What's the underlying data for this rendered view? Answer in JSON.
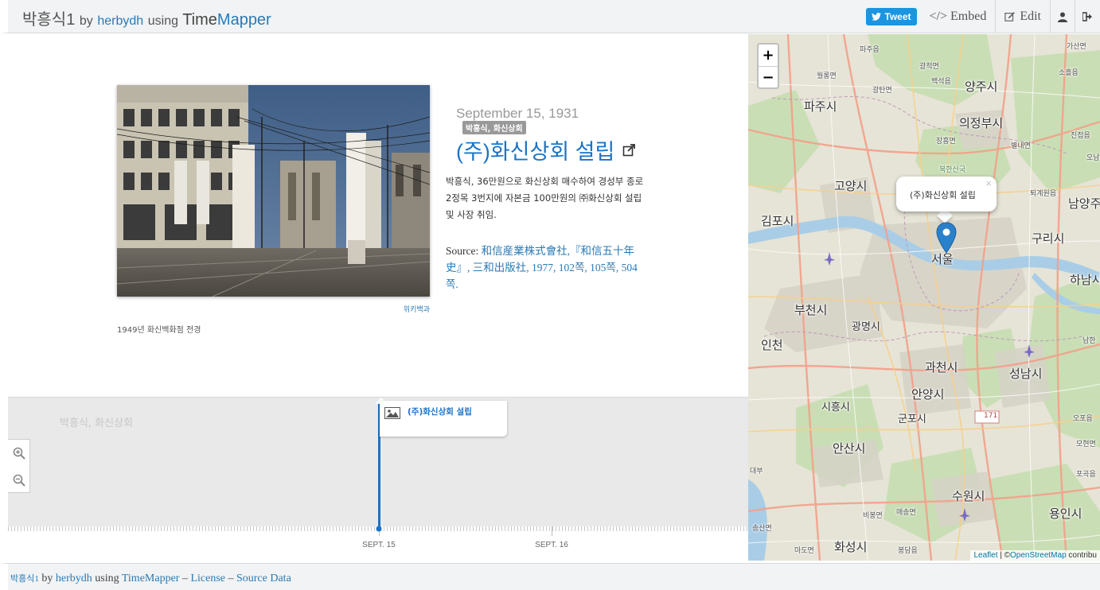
{
  "header": {
    "title": "박흥식1",
    "by": "by",
    "author": "herbydh",
    "using": "using",
    "app_name_1": "Time",
    "app_name_2": "Mapper",
    "tweet_label": "Tweet",
    "embed_label": "</> Embed",
    "edit_label": "Edit"
  },
  "slide": {
    "date": "September 15, 1931",
    "tag": "박흥식, 화신상회",
    "headline": "(주)화신상회 설립",
    "body": "박흥식, 36만원으로 화신상회 매수하여 경성부 종로 2정목 3번지에 자본금 100만원의 ㈜화신상회 설립 및 사장 취임.",
    "source_prefix": "Source:",
    "source_link": "和信産業株式會社,『和信五十年史』, 三和出版社, 1977, 102쪽, 105쪽, 504쪽.",
    "media_credit": "위키백과",
    "media_caption": "1949년 화신백화점 전경"
  },
  "timeline": {
    "group_label": "박흥식, 화신상회",
    "event_title": "(주)화신상회 설립",
    "tick_labels": [
      "SEPT. 15",
      "SEPT. 16"
    ]
  },
  "map": {
    "popup_text": "(주)화신상회 설립",
    "popup_close": "×",
    "zoom_in": "+",
    "zoom_out": "−",
    "attribution_leaflet": "Leaflet",
    "attribution_sep": " | ©",
    "attribution_osm": "OpenStreetMap",
    "attribution_tail": " contribu",
    "road_number": "171",
    "places": {
      "seoul": "서울",
      "goyang": "고양시",
      "gimpo": "김포시",
      "bucheon": "부천시",
      "incheon": "인천",
      "gwangmyeong": "광명시",
      "uijeongbu": "의정부시",
      "yangju": "양주시",
      "paju": "파주시",
      "guri": "구리시",
      "namyangju": "남양주",
      "hanam": "하남시",
      "seongnam": "성남시",
      "gwacheon": "과천시",
      "anyang": "안양시",
      "gunpo": "군포시",
      "ansan": "안산시",
      "siheung": "시흥시",
      "suwon": "수원시",
      "yongin": "용인시",
      "hwaseong": "화성시",
      "gwangjeok": "광적면",
      "baekseok": "백석읍",
      "gwangtan": "광탄면",
      "jangheung": "장흥면",
      "bukhansan": "북한산국",
      "byeollae": "별내면",
      "jinjeop": "진접읍",
      "toegyewon": "퇴계원읍",
      "namhan": "남한",
      "ojeon": "오포읍",
      "mohyeon": "모현면",
      "pogok": "포곡읍",
      "maesong": "매송면",
      "bibong": "비봉면",
      "bongdam": "봉담읍",
      "songsan": "송산면",
      "madoe": "마도면",
      "gasan": "가산면",
      "soheul": "소흘읍",
      "ojeong": "오남",
      "paju2": "파주읍",
      "wollong": "월롱면",
      "daebu": "대부"
    }
  },
  "footer": {
    "title": "박흥식1",
    "by": "by",
    "author": "herbydh",
    "using": "using",
    "app": "TimeMapper",
    "sep1": "–",
    "license": "License",
    "sep2": "–",
    "source_data": "Source Data"
  }
}
